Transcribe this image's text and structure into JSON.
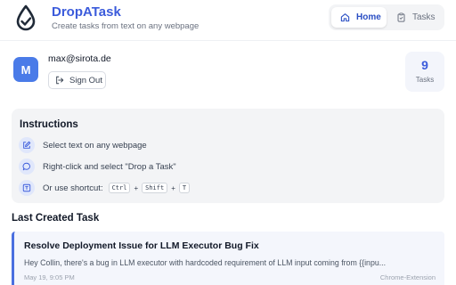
{
  "header": {
    "title": "DropATask",
    "subtitle": "Create tasks from text on any webpage",
    "logo_icon": "droplet-check-logo",
    "nav": {
      "home_label": "Home",
      "tasks_label": "Tasks",
      "active": "Home"
    }
  },
  "user": {
    "avatar_initial": "M",
    "email": "max@sirota.de",
    "sign_out_label": "Sign Out"
  },
  "stats": {
    "count": "9",
    "label": "Tasks"
  },
  "instructions": {
    "title": "Instructions",
    "step1": "Select text on any webpage",
    "step2": "Right-click and select \"Drop a Task\"",
    "step3_prefix": "Or use shortcut:",
    "keys": [
      "Ctrl",
      "Shift",
      "T"
    ]
  },
  "last_task": {
    "section_title": "Last Created Task",
    "title": "Resolve Deployment Issue for LLM Executor Bug Fix",
    "preview": "Hey Collin, there's a bug in LLM executor with hardcoded requirement of LLM input coming from {{inpu...",
    "date": "May 19, 9:05 PM",
    "source": "Chrome-Extension"
  },
  "colors": {
    "accent": "#3b5bdb",
    "avatar": "#4a7be8",
    "panel": "#f3f4f6"
  }
}
